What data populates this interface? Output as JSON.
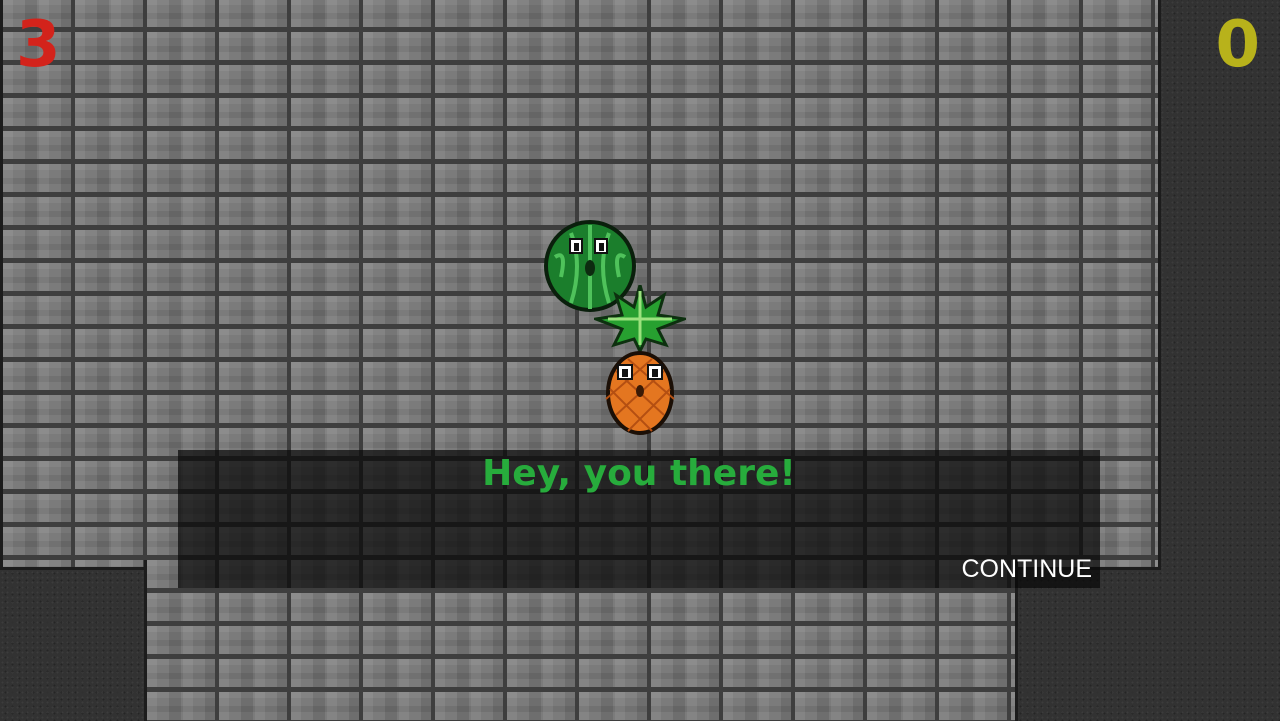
{
  "hud": {
    "lives": "3",
    "coins": "0",
    "lives_color": "#d3231b",
    "coins_color": "#b8b21b"
  },
  "characters": {
    "watermelon": "watermelon",
    "pineapple": "pineapple"
  },
  "dialog": {
    "text": "Hey, you there!",
    "continue_label": "CONTINUE",
    "text_color": "#27ac3c"
  }
}
